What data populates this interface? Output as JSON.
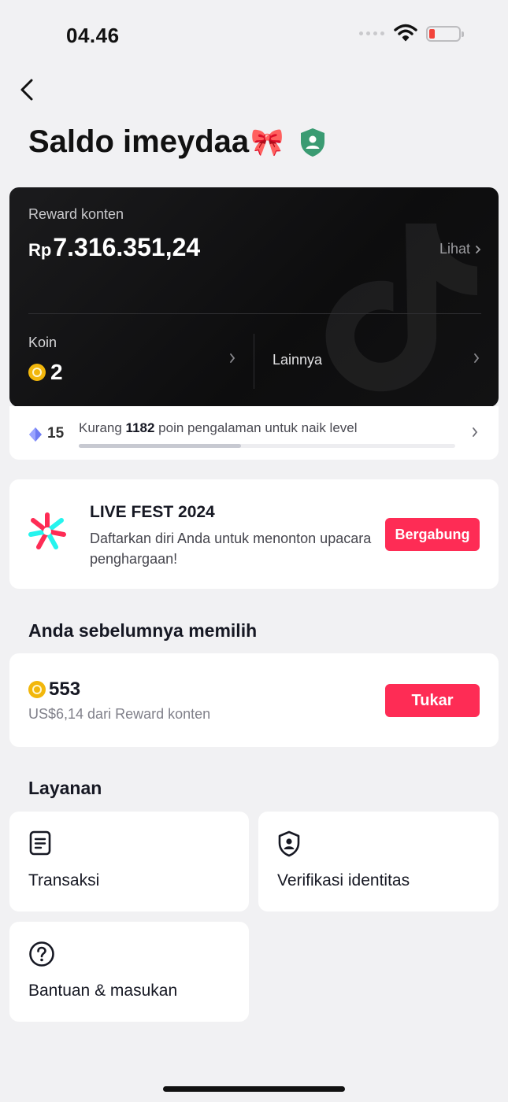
{
  "status_bar": {
    "time": "04.46"
  },
  "header": {
    "title": "Saldo imeydaa",
    "title_emoji": "🎀"
  },
  "balance": {
    "reward_label": "Reward konten",
    "currency": "Rp",
    "amount": "7.316.351,24",
    "lihat_label": "Lihat",
    "koin_label": "Koin",
    "koin_value": "2",
    "lainnya_label": "Lainnya"
  },
  "level": {
    "number": "15",
    "text_prefix": "Kurang ",
    "points": "1182",
    "text_suffix": " poin pengalaman untuk naik level",
    "progress_fraction": 0.43
  },
  "live_fest": {
    "title": "LIVE FEST 2024",
    "description": "Daftarkan diri Anda untuk menonton upacara penghargaan!",
    "button_label": "Bergabung"
  },
  "previous_choice": {
    "section_title": "Anda sebelumnya memilih",
    "coins": "553",
    "subtitle": "US$6,14 dari Reward konten",
    "button_label": "Tukar"
  },
  "services": {
    "section_title": "Layanan",
    "items": [
      {
        "label": "Transaksi",
        "icon": "document-icon"
      },
      {
        "label": "Verifikasi identitas",
        "icon": "shield-user-icon"
      },
      {
        "label": "Bantuan & masukan",
        "icon": "question-circle-icon"
      }
    ]
  },
  "colors": {
    "accent": "#fe2c55",
    "coin": "#f2b70c",
    "card_dark": "#141415",
    "verified_green": "#3a9b72"
  }
}
